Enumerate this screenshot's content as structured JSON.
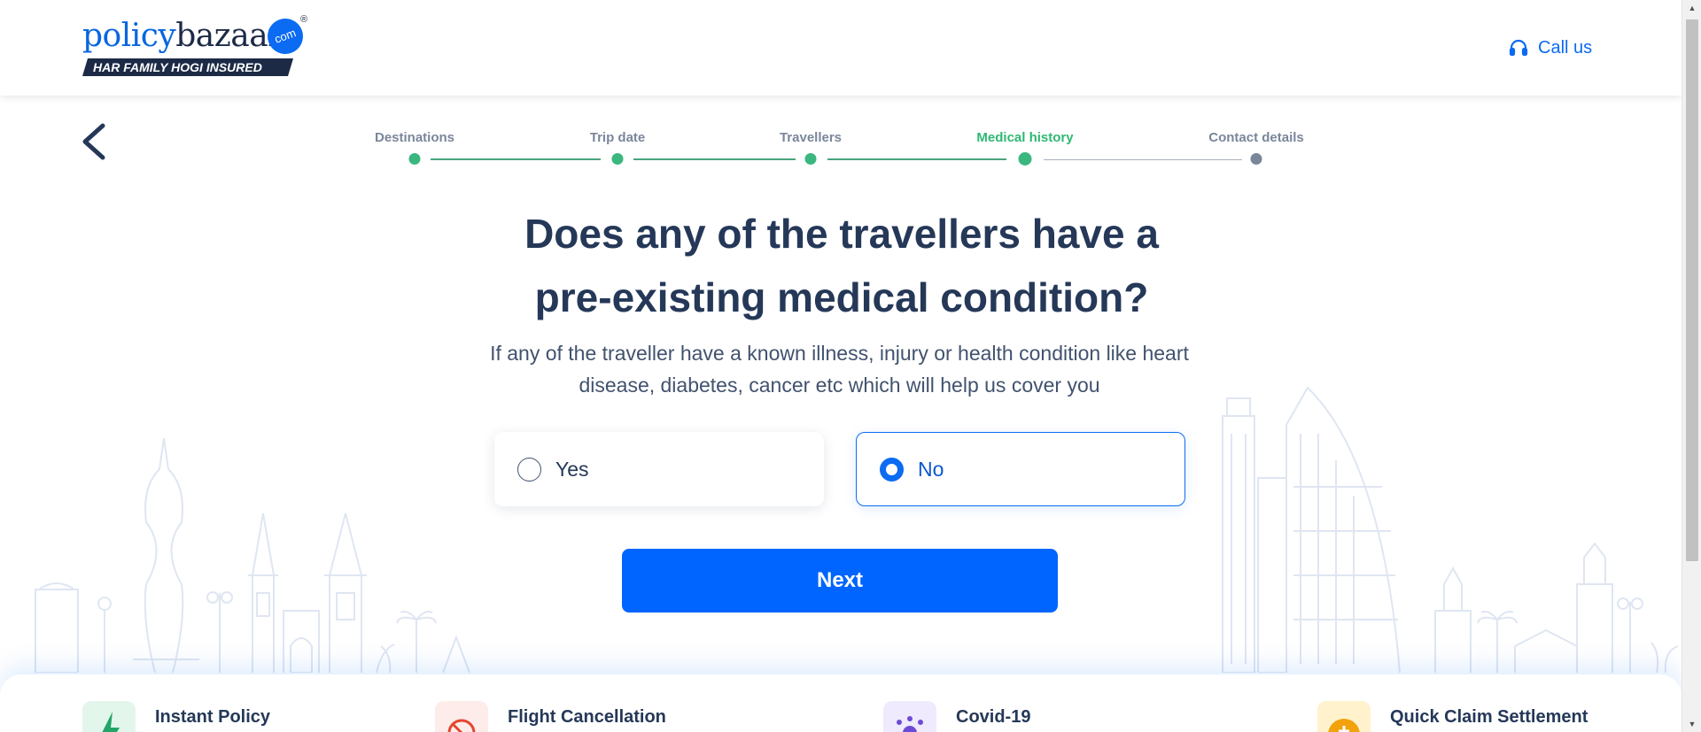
{
  "header": {
    "logo_policy": "policy",
    "logo_bazaar": "bazaar",
    "logo_com": "com",
    "logo_reg": "®",
    "logo_tagline": "HAR FAMILY HOGI INSURED",
    "call_us_label": "Call us",
    "call_icon": "headset-icon"
  },
  "stepper": {
    "steps": [
      {
        "label": "Destinations",
        "status": "done"
      },
      {
        "label": "Trip date",
        "status": "done"
      },
      {
        "label": "Travellers",
        "status": "done"
      },
      {
        "label": "Medical history",
        "status": "current"
      },
      {
        "label": "Contact details",
        "status": "pending"
      }
    ]
  },
  "question": {
    "line1": "Does any of the travellers have a",
    "line2": "pre-existing medical condition?",
    "subtitle_line1": "If any of the traveller have a known illness, injury or health condition like heart",
    "subtitle_line2": "disease, diabetes, cancer etc which will help us cover you"
  },
  "options": {
    "yes_label": "Yes",
    "no_label": "No",
    "selected": "No"
  },
  "next_label": "Next",
  "features": [
    {
      "title": "Instant Policy",
      "icon": "lightning-icon"
    },
    {
      "title": "Flight Cancellation",
      "icon": "flight-cancel-icon"
    },
    {
      "title": "Covid-19",
      "icon": "virus-icon"
    },
    {
      "title": "Quick Claim Settlement",
      "icon": "claim-icon"
    }
  ],
  "colors": {
    "primary": "#0065ff",
    "navy": "#253858",
    "step_active": "#2eb872",
    "step_pending": "#7a869a"
  }
}
